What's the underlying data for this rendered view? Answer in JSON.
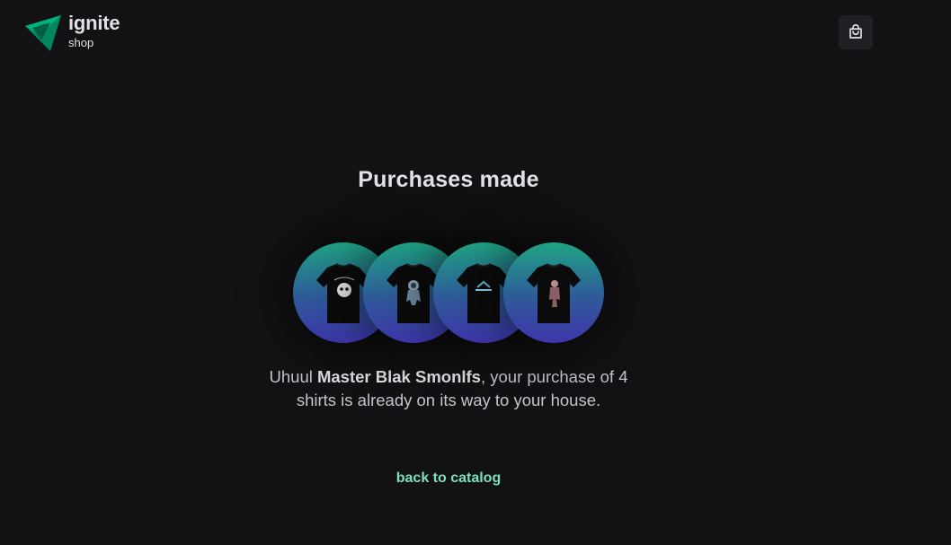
{
  "header": {
    "logo_title": "ignite",
    "logo_sub": "shop",
    "cart_icon": "shopping-bag-icon"
  },
  "main": {
    "title": "Purchases made",
    "message": {
      "prefix": "Uhuul ",
      "name": "Master Blak Smonlfs",
      "suffix": ", your purchase of 4 shirts is already on its way to your house."
    },
    "shirts": [
      {
        "icon": "tshirt-skull-print-icon",
        "print": "skull"
      },
      {
        "icon": "tshirt-astronaut-print-icon",
        "print": "astronaut"
      },
      {
        "icon": "tshirt-logo-print-icon",
        "print": "logo"
      },
      {
        "icon": "tshirt-figure-print-icon",
        "print": "figure"
      }
    ],
    "back_link": "back to catalog"
  },
  "colors": {
    "background": "#121214",
    "accent": "#00b37e",
    "link": "#7de0bd",
    "gradient_top": "#1ea483",
    "gradient_bottom": "#7465d4"
  }
}
